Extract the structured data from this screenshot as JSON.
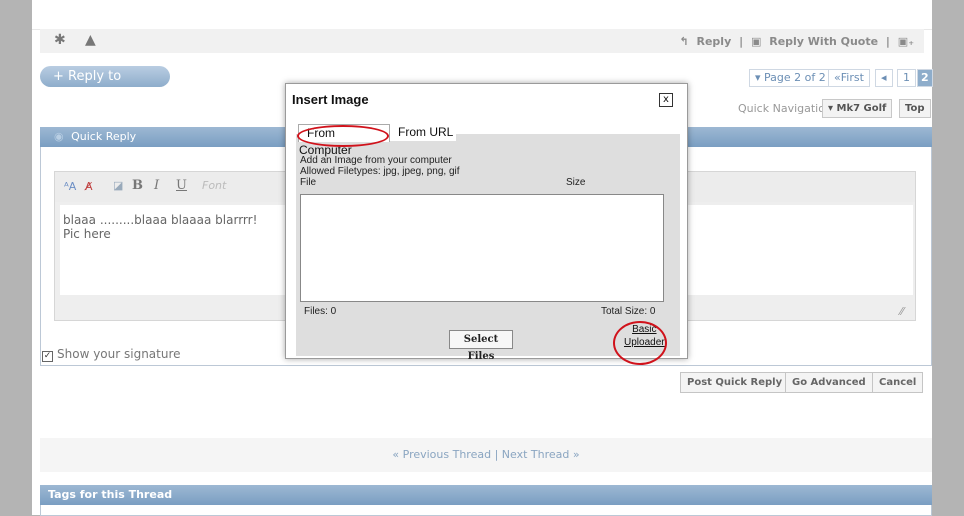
{
  "post_actions": {
    "reply": "Reply",
    "separator": "|",
    "reply_with_quote": "Reply With Quote"
  },
  "reply_to_thread": "+ Reply to Thread",
  "pagination": {
    "page_label": "▾ Page 2 of 2",
    "first": "«First",
    "prev": "◂",
    "page1": "1",
    "page2": "2"
  },
  "quick_nav": {
    "label": "Quick Navigation",
    "forum_select": "▾ Mk7 Golf",
    "top": "Top"
  },
  "quick_reply": {
    "title": "Quick Reply",
    "font_placeholder": "Font",
    "text_line1": "blaaa .........blaaa blaaaa blarrrr!",
    "text_line2": "Pic here",
    "show_signature": "Show your signature",
    "post_button": "Post Quick Reply",
    "advanced_button": "Go Advanced",
    "cancel_button": "Cancel"
  },
  "thread_nav": "« Previous Thread | Next Thread »",
  "tags_title": "Tags for this Thread",
  "dialog": {
    "title": "Insert Image",
    "close": "x",
    "tab_computer": "From Computer",
    "tab_url": "From URL",
    "intro": "Add an Image from your computer",
    "filetypes": "Allowed Filetypes: jpg, jpeg, png, gif",
    "col_file": "File",
    "col_size": "Size",
    "files_count": "Files: 0",
    "total_size": "Total Size: 0",
    "select_files": "Select Files",
    "basic": "Basic",
    "uploader": "Uploader"
  },
  "colors": {
    "accent": "#8eadcb",
    "annotation": "#d0121b",
    "link": "#6c8fb5"
  }
}
